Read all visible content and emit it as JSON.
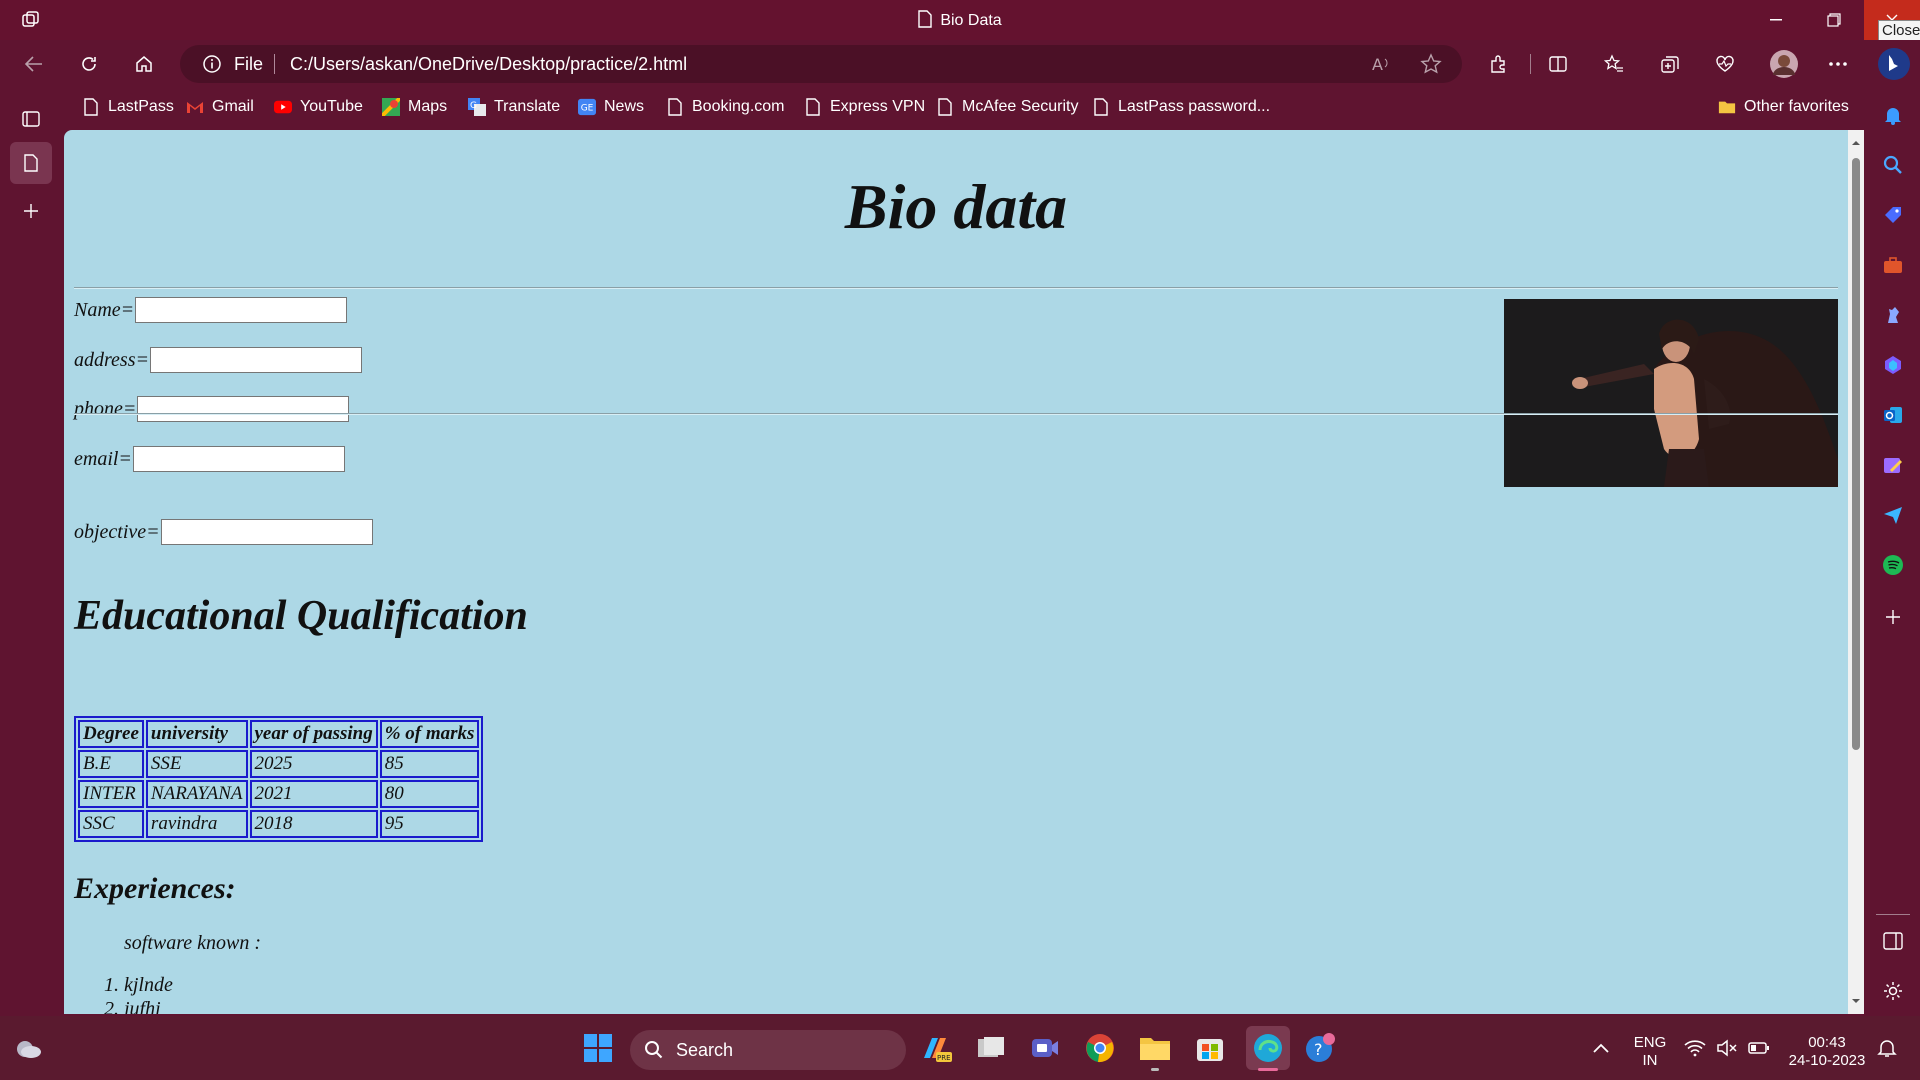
{
  "window": {
    "tab_title": "Bio Data",
    "close_tooltip": "Close"
  },
  "address_bar": {
    "scheme_label": "File",
    "url": "C:/Users/askan/OneDrive/Desktop/practice/2.html"
  },
  "favorites": [
    {
      "label": "LastPass",
      "icon": "page-icon"
    },
    {
      "label": "Gmail",
      "icon": "gmail-icon"
    },
    {
      "label": "YouTube",
      "icon": "youtube-icon"
    },
    {
      "label": "Maps",
      "icon": "maps-icon"
    },
    {
      "label": "Translate",
      "icon": "translate-icon"
    },
    {
      "label": "News",
      "icon": "news-icon"
    },
    {
      "label": "Booking.com",
      "icon": "page-icon"
    },
    {
      "label": "Express VPN",
      "icon": "page-icon"
    },
    {
      "label": "McAfee Security",
      "icon": "page-icon"
    },
    {
      "label": "LastPass password...",
      "icon": "page-icon"
    }
  ],
  "other_favorites": "Other favorites",
  "page": {
    "heading": "Bio data",
    "fields": {
      "name": "Name=",
      "address": "address=",
      "phone": "phone=",
      "email": "email=",
      "objective": "objective="
    },
    "edu_heading": "Educational Qualification",
    "table": {
      "headers": [
        "Degree",
        "university",
        "year of passing",
        "% of marks"
      ],
      "rows": [
        [
          "B.E",
          "SSE",
          "2025",
          "85"
        ],
        [
          "INTER",
          "NARAYANA",
          "2021",
          "80"
        ],
        [
          "SSC",
          "ravindra",
          "2018",
          "95"
        ]
      ]
    },
    "exp_heading": "Experiences:",
    "software_label": "software known :",
    "software_list": [
      "kjlnde",
      "jufhi"
    ]
  },
  "taskbar": {
    "search_label": "Search",
    "lang": "ENG",
    "region": "IN",
    "time": "00:43",
    "date": "24-10-2023"
  },
  "colors": {
    "chrome": "#5f1430",
    "page_bg": "#add8e6",
    "table_border": "#1a1acc",
    "close_red": "#c42b1c"
  }
}
